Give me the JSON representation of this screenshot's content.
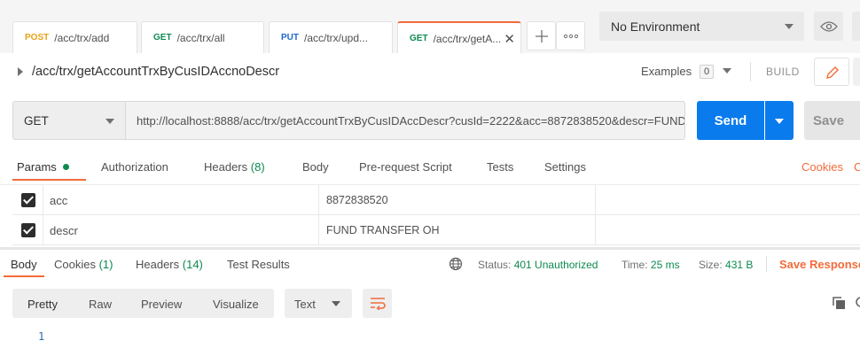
{
  "tabs": [
    {
      "method": "POST",
      "path": "/acc/trx/add"
    },
    {
      "method": "GET",
      "path": "/acc/trx/all"
    },
    {
      "method": "PUT",
      "path": "/acc/trx/upd..."
    },
    {
      "method": "GET",
      "path": "/acc/trx/getA..."
    }
  ],
  "environment": {
    "selected": "No Environment"
  },
  "request": {
    "title": "/acc/trx/getAccountTrxByCusIDAccnoDescr",
    "examples_label": "Examples",
    "examples_count": "0",
    "build_label": "BUILD",
    "method": "GET",
    "url": "http://localhost:8888/acc/trx/getAccountTrxByCusIDAccDescr?cusId=2222&acc=8872838520&descr=FUND TRANSFER OH",
    "send_label": "Send",
    "save_label": "Save"
  },
  "request_tabs": {
    "params": "Params",
    "authorization": "Authorization",
    "headers": "Headers",
    "headers_count": "(8)",
    "body": "Body",
    "prerequest": "Pre-request Script",
    "tests": "Tests",
    "settings": "Settings",
    "cookies": "Cookies",
    "code": "C"
  },
  "params": [
    {
      "key": "acc",
      "value": "8872838520",
      "checked": true
    },
    {
      "key": "descr",
      "value": "FUND TRANSFER OH",
      "checked": true
    }
  ],
  "response": {
    "tabs": {
      "body": "Body",
      "cookies": "Cookies",
      "cookies_count": "(1)",
      "headers": "Headers",
      "headers_count": "(14)",
      "test_results": "Test Results"
    },
    "status_label": "Status:",
    "status_value": "401 Unauthorized",
    "time_label": "Time:",
    "time_value": "25 ms",
    "size_label": "Size:",
    "size_value": "431 B",
    "save_response": "Save Response",
    "views": {
      "pretty": "Pretty",
      "raw": "Raw",
      "preview": "Preview",
      "visualize": "Visualize"
    },
    "format": "Text",
    "line_number": "1"
  },
  "colors": {
    "accent": "#f26b3a",
    "send": "#097bed",
    "success": "#0d8a4f"
  }
}
